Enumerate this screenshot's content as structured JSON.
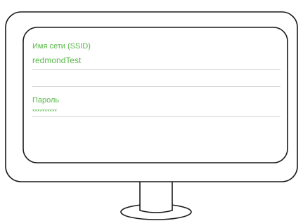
{
  "form": {
    "ssid": {
      "label": "Имя сети (SSID)",
      "value": "redmondTest"
    },
    "password": {
      "label": "Пароль",
      "value": "**********"
    }
  },
  "colors": {
    "accent": "#57b947",
    "outline": "#1a1a1a",
    "divider": "#cfcfcf"
  },
  "icons": {
    "illustration": "monitor-icon"
  }
}
